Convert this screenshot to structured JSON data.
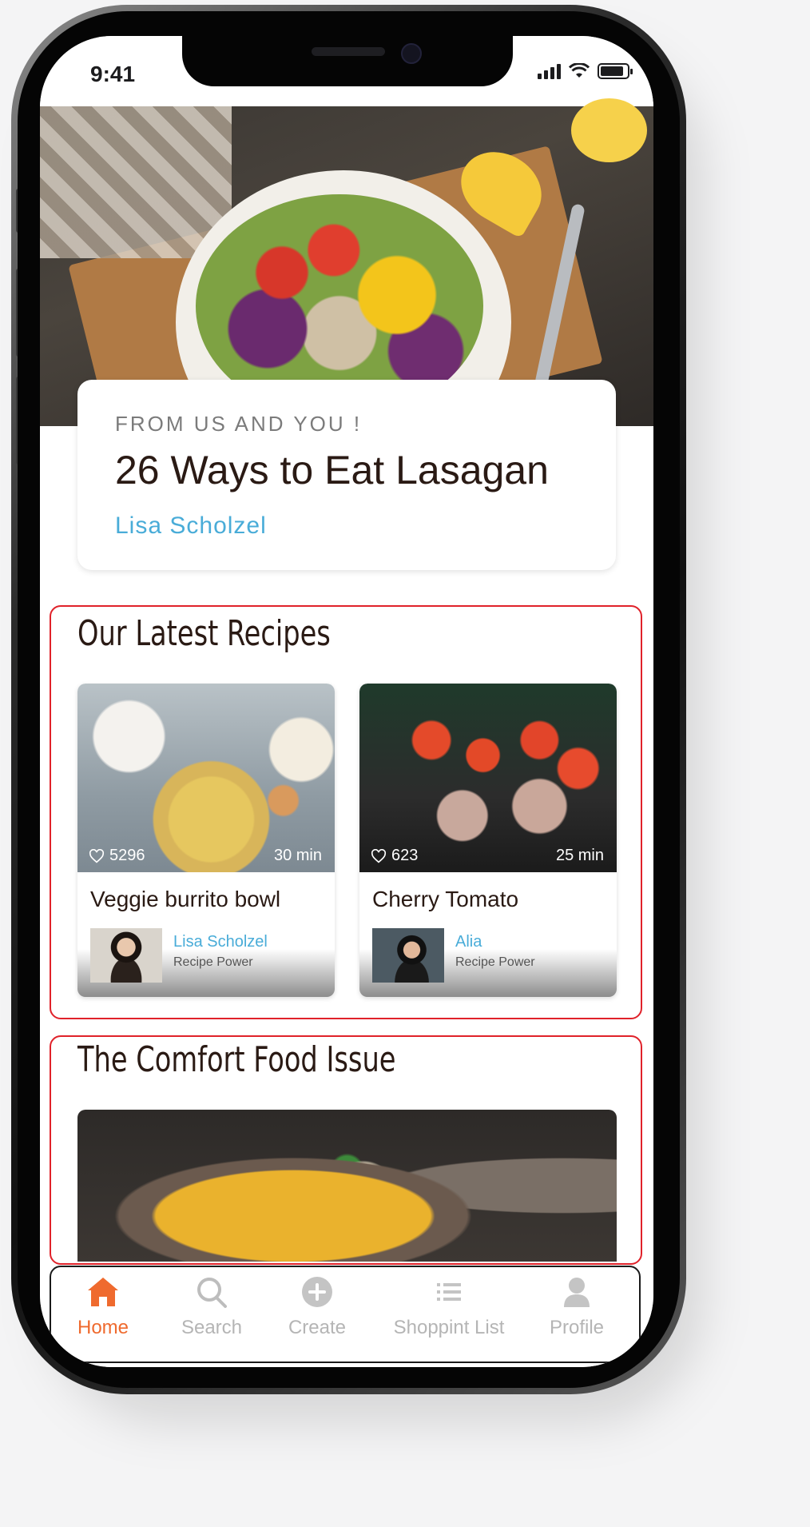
{
  "status_bar": {
    "time": "9:41"
  },
  "hero": {
    "kicker": "FROM US AND YOU !",
    "title": "26 Ways to Eat Lasagan",
    "author": "Lisa Scholzel"
  },
  "latest": {
    "title": "Our Latest Recipes",
    "recipes": [
      {
        "likes": "5296",
        "duration": "30 min",
        "title": "Veggie burrito bowl",
        "author": "Lisa Scholzel",
        "publisher": "Recipe Power"
      },
      {
        "likes": "623",
        "duration": "25 min",
        "title": "Cherry Tomato",
        "author": "Alia",
        "publisher": "Recipe Power"
      }
    ]
  },
  "comfort": {
    "title": "The Comfort Food Issue"
  },
  "tabs": [
    {
      "label": "Home",
      "icon": "home-icon",
      "active": true
    },
    {
      "label": "Search",
      "icon": "search-icon",
      "active": false
    },
    {
      "label": "Create",
      "icon": "plus-circle-icon",
      "active": false
    },
    {
      "label": "Shoppint List",
      "icon": "list-icon",
      "active": false
    },
    {
      "label": "Profile",
      "icon": "user-icon",
      "active": false
    }
  ],
  "colors": {
    "accent": "#ef6a2e",
    "link": "#49acd8",
    "highlight_border": "#e0222a"
  }
}
